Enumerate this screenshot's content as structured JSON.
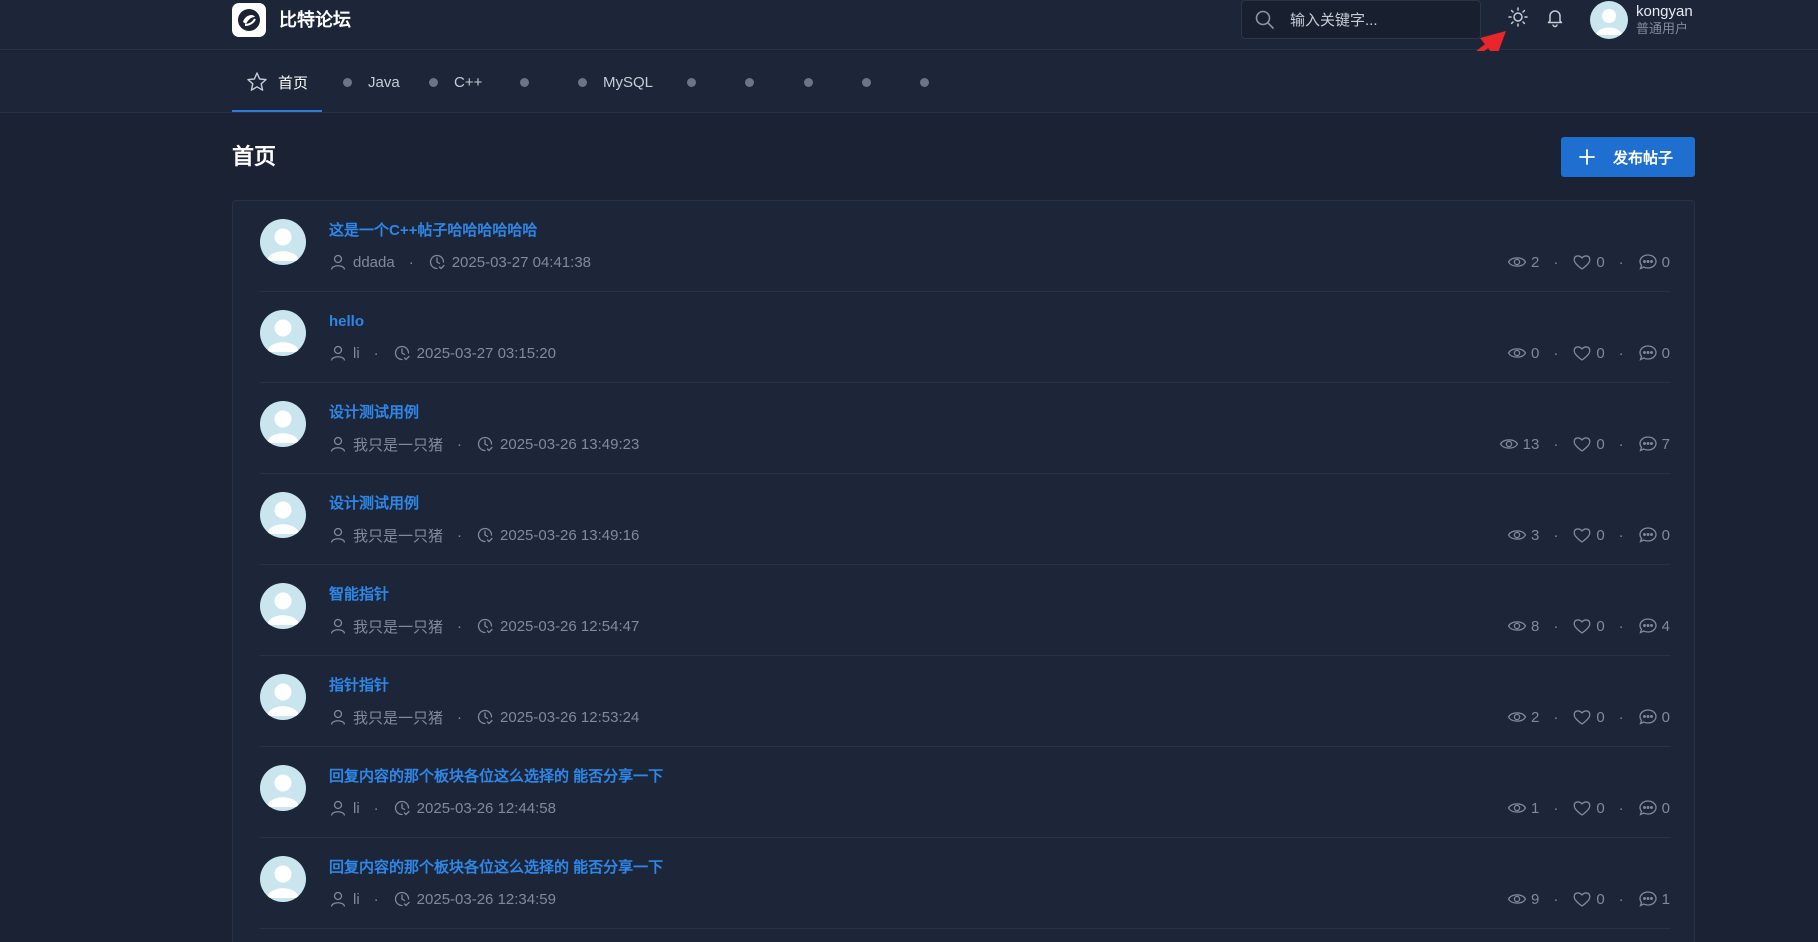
{
  "header": {
    "brand": "比特论坛",
    "search_placeholder": "输入关键字...",
    "user": {
      "name": "kongyan",
      "role": "普通用户"
    }
  },
  "nav": {
    "tabs": [
      {
        "label": "首页",
        "active": true
      },
      {
        "label": "Java"
      },
      {
        "label": "C++"
      },
      {
        "label": ""
      },
      {
        "label": "MySQL"
      },
      {
        "label": ""
      },
      {
        "label": ""
      },
      {
        "label": ""
      },
      {
        "label": ""
      },
      {
        "label": ""
      }
    ]
  },
  "main": {
    "title": "首页",
    "publish_label": "发布帖子"
  },
  "posts": [
    {
      "title": "这是一个C++帖子哈哈哈哈哈哈",
      "author": "ddada",
      "time": "2025-03-27 04:41:38",
      "views": "2",
      "likes": "0",
      "comments": "0"
    },
    {
      "title": "hello",
      "author": "li",
      "time": "2025-03-27 03:15:20",
      "views": "0",
      "likes": "0",
      "comments": "0"
    },
    {
      "title": "设计测试用例",
      "author": "我只是一只猪",
      "time": "2025-03-26 13:49:23",
      "views": "13",
      "likes": "0",
      "comments": "7"
    },
    {
      "title": "设计测试用例",
      "author": "我只是一只猪",
      "time": "2025-03-26 13:49:16",
      "views": "3",
      "likes": "0",
      "comments": "0"
    },
    {
      "title": "智能指针",
      "author": "我只是一只猪",
      "time": "2025-03-26 12:54:47",
      "views": "8",
      "likes": "0",
      "comments": "4"
    },
    {
      "title": "指针指针",
      "author": "我只是一只猪",
      "time": "2025-03-26 12:53:24",
      "views": "2",
      "likes": "0",
      "comments": "0"
    },
    {
      "title": "回复内容的那个板块各位这么选择的 能否分享一下",
      "author": "li",
      "time": "2025-03-26 12:44:58",
      "views": "1",
      "likes": "0",
      "comments": "0"
    },
    {
      "title": "回复内容的那个板块各位这么选择的 能否分享一下",
      "author": "li",
      "time": "2025-03-26 12:34:59",
      "views": "9",
      "likes": "0",
      "comments": "1"
    }
  ],
  "icons": {
    "logo": "bit-logo-icon",
    "search": "search-icon",
    "theme": "sun-icon",
    "notify": "bell-icon",
    "home": "star-icon",
    "publish": "plus-icon",
    "author": "user-icon",
    "time": "clock-icon",
    "views": "eye-icon",
    "likes": "heart-icon",
    "comments": "comment-icon",
    "annotation": "red-arrow-icon"
  },
  "colors": {
    "background": "#1a2233",
    "surface": "#1c2638",
    "accent": "#1f6fd1",
    "link": "#2f86e6",
    "muted": "#7f8a9c",
    "annotation": "#e8262b"
  }
}
